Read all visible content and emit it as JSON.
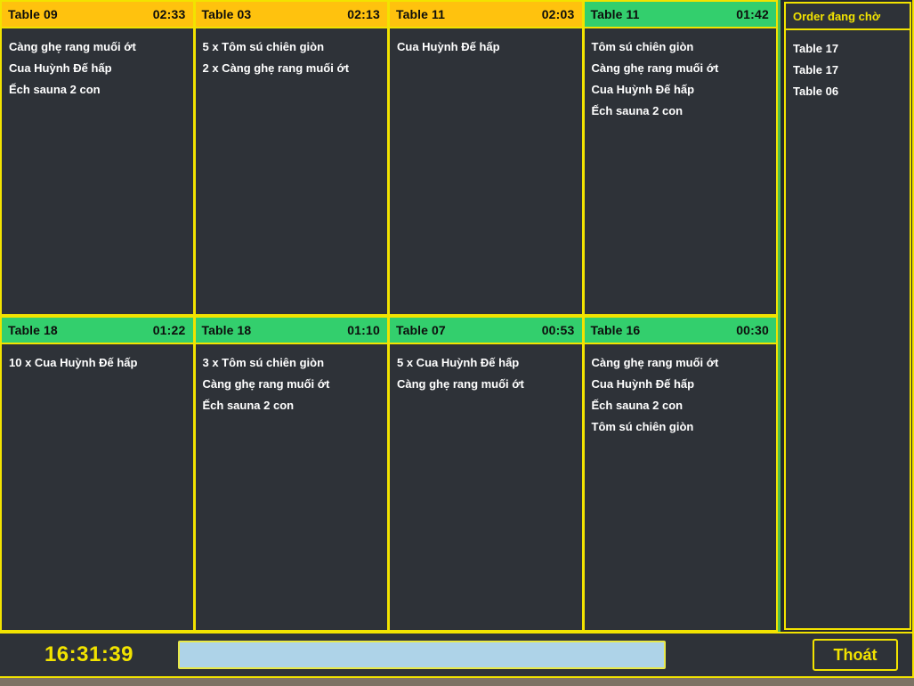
{
  "window": {
    "accent_yellow": "#f2e300",
    "status_amber": "#ffc20e",
    "status_green": "#33cf6d",
    "card_body_bg": "#2e3238"
  },
  "orders": [
    {
      "table": "Table 09",
      "timer": "02:33",
      "status": "amber",
      "items": [
        "Càng ghẹ rang muối ớt",
        "Cua Huỳnh Đế hấp",
        "Ếch sauna 2 con"
      ]
    },
    {
      "table": "Table 03",
      "timer": "02:13",
      "status": "amber",
      "items": [
        "5 x Tôm sú chiên giòn",
        "2 x Càng ghẹ rang muối ớt"
      ]
    },
    {
      "table": "Table 11",
      "timer": "02:03",
      "status": "amber",
      "items": [
        "Cua Huỳnh Đế hấp"
      ]
    },
    {
      "table": "Table 11",
      "timer": "01:42",
      "status": "green",
      "items": [
        "Tôm sú chiên giòn",
        "Càng ghẹ rang muối ớt",
        "Cua Huỳnh Đế hấp",
        "Ếch sauna 2 con"
      ]
    },
    {
      "table": "Table 18",
      "timer": "01:22",
      "status": "green",
      "items": [
        "10 x Cua Huỳnh Đế hấp"
      ]
    },
    {
      "table": "Table 18",
      "timer": "01:10",
      "status": "green",
      "items": [
        "3 x Tôm sú chiên giòn",
        "Càng ghẹ rang muối ớt",
        "Ếch sauna 2 con"
      ]
    },
    {
      "table": "Table 07",
      "timer": "00:53",
      "status": "green",
      "items": [
        "5 x Cua Huỳnh Đế hấp",
        "Càng ghẹ rang muối ớt"
      ]
    },
    {
      "table": "Table 16",
      "timer": "00:30",
      "status": "green",
      "items": [
        "Càng ghẹ rang muối ớt",
        "Cua Huỳnh Đế hấp",
        "Ếch sauna 2 con",
        "Tôm sú chiên giòn"
      ]
    }
  ],
  "pending": {
    "title": "Order đang chờ",
    "items": [
      "Table 17",
      "Table 17",
      "Table 06"
    ]
  },
  "bottom_bar": {
    "clock": "16:31:39",
    "input_value": "",
    "input_placeholder": "",
    "exit_label": "Thoát"
  }
}
